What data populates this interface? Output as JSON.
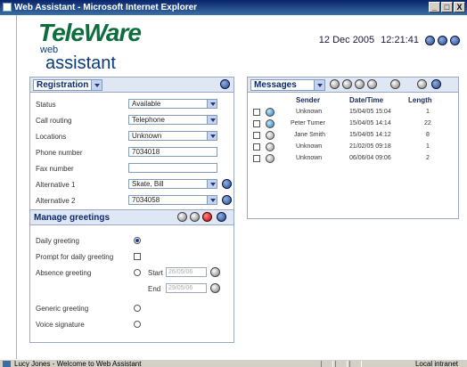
{
  "window": {
    "title": "Web Assistant - Microsoft Internet Explorer",
    "buttons": [
      "_",
      "□",
      "X"
    ]
  },
  "logo": {
    "main": "TeleWare",
    "web": "web",
    "sub": "assistant"
  },
  "header": {
    "date": "12 Dec 2005",
    "time": "12:21:41"
  },
  "registration": {
    "title": "Registration",
    "fields": [
      {
        "label": "Status",
        "value": "Available",
        "type": "select"
      },
      {
        "label": "Call routing",
        "value": "Telephone",
        "type": "select"
      },
      {
        "label": "Locations",
        "value": "Unknown",
        "type": "select"
      },
      {
        "label": "Phone number",
        "value": "7034018",
        "type": "text"
      },
      {
        "label": "Fax number",
        "value": "",
        "type": "text"
      },
      {
        "label": "Alternative 1",
        "value": "Skate, Bill",
        "type": "select"
      },
      {
        "label": "Alternative 2",
        "value": "7034058",
        "type": "select"
      }
    ]
  },
  "greetings": {
    "title": "Manage greetings",
    "daily": "Daily greeting",
    "prompt": "Prompt for daily greeting",
    "absence": "Absence greeting",
    "start_label": "Start",
    "start_value": "26/05/06",
    "end_label": "End",
    "end_value": "29/05/06",
    "generic": "Generic greeting",
    "voice": "Voice signature"
  },
  "messages": {
    "title": "Messages",
    "columns": [
      "Sender",
      "Date/Time",
      "Length"
    ],
    "rows": [
      {
        "sender": "Unknown",
        "datetime": "15/04/05 15:04",
        "length": "1",
        "icon": "blue"
      },
      {
        "sender": "Peter Turner",
        "datetime": "15/04/05 14:14",
        "length": "22",
        "icon": "blue"
      },
      {
        "sender": "Jane Smith",
        "datetime": "15/04/05 14:12",
        "length": "8",
        "icon": "grey"
      },
      {
        "sender": "Unknown",
        "datetime": "21/02/05 09:18",
        "length": "1",
        "icon": "grey"
      },
      {
        "sender": "Unknown",
        "datetime": "06/06/04 09:06",
        "length": "2",
        "icon": "grey"
      }
    ]
  },
  "statusbar": {
    "text": "Lucy Jones - Welcome to Web Assistant",
    "zone": "Local intranet"
  }
}
